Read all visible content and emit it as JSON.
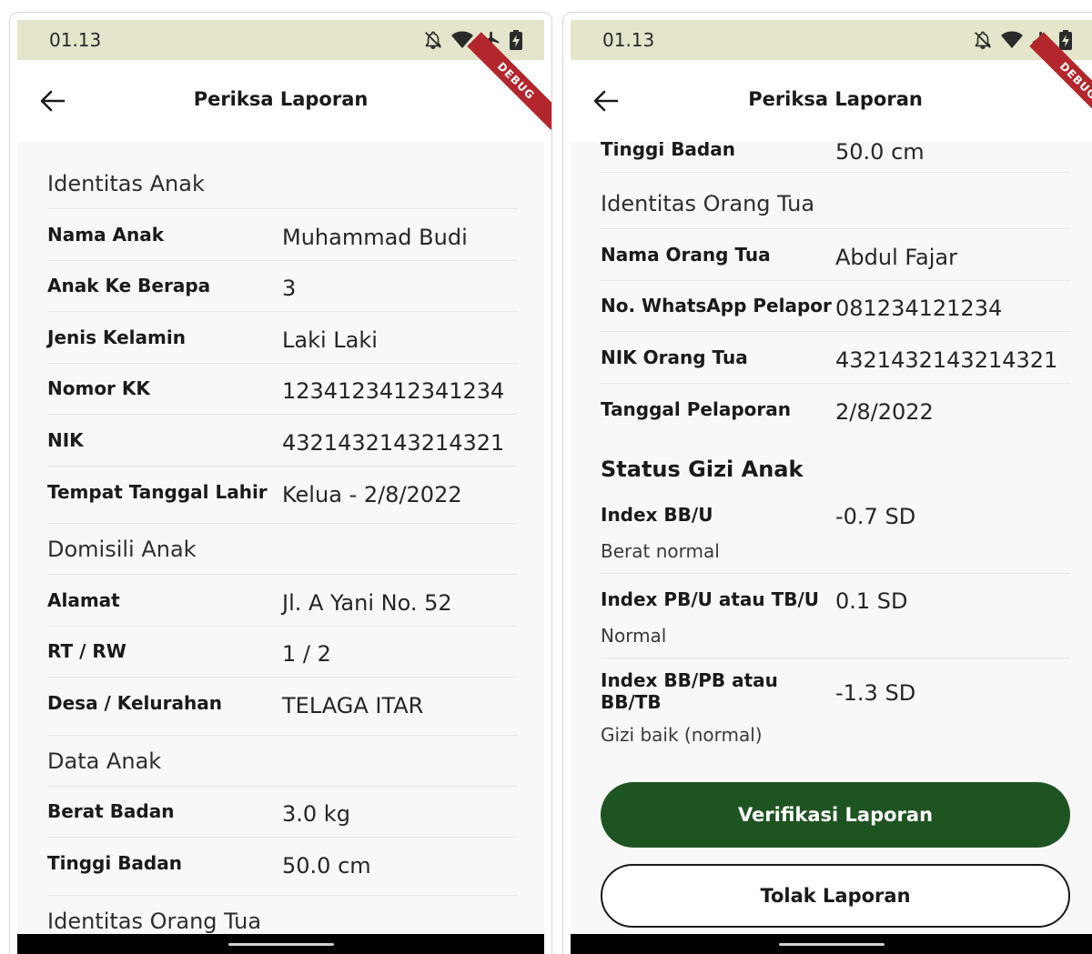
{
  "status_bar": {
    "time": "01.13"
  },
  "app_bar": {
    "title": "Periksa Laporan",
    "debug_label": "DEBUG"
  },
  "left": {
    "sections": [
      {
        "title": "Identitas Anak",
        "rows": [
          {
            "label": "Nama Anak",
            "value": "Muhammad Budi"
          },
          {
            "label": "Anak Ke Berapa",
            "value": "3"
          },
          {
            "label": "Jenis Kelamin",
            "value": "Laki Laki"
          },
          {
            "label": "Nomor KK",
            "value": "1234123412341234"
          },
          {
            "label": "NIK",
            "value": "4321432143214321"
          },
          {
            "label": "Tempat Tanggal Lahir",
            "value": "Kelua - 2/8/2022"
          }
        ]
      },
      {
        "title": "Domisili Anak",
        "rows": [
          {
            "label": "Alamat",
            "value": "Jl. A Yani No. 52"
          },
          {
            "label": "RT / RW",
            "value": "1 / 2"
          },
          {
            "label": "Desa / Kelurahan",
            "value": "TELAGA ITAR"
          }
        ]
      },
      {
        "title": "Data Anak",
        "rows": [
          {
            "label": "Berat Badan",
            "value": "3.0 kg"
          },
          {
            "label": "Tinggi Badan",
            "value": "50.0 cm"
          }
        ]
      }
    ],
    "partial_next_title": "Identitas Orang Tua"
  },
  "right": {
    "partial_row": {
      "label": "Tinggi Badan",
      "value": "50.0 cm"
    },
    "section": {
      "title": "Identitas Orang Tua",
      "rows": [
        {
          "label": "Nama Orang Tua",
          "value": "Abdul Fajar"
        },
        {
          "label": "No. WhatsApp Pelapor",
          "value": "081234121234"
        },
        {
          "label": "NIK Orang Tua",
          "value": "4321432143214321"
        },
        {
          "label": "Tanggal Pelaporan",
          "value": "2/8/2022"
        }
      ]
    },
    "status_gizi": {
      "title": "Status Gizi Anak",
      "items": [
        {
          "label": "Index BB/U",
          "value": "-0.7 SD",
          "desc": "Berat normal"
        },
        {
          "label": "Index PB/U atau TB/U",
          "value": "0.1 SD",
          "desc": "Normal"
        },
        {
          "label": "Index BB/PB atau BB/TB",
          "value": "-1.3 SD",
          "desc": "Gizi baik (normal)"
        }
      ]
    },
    "buttons": {
      "verify_label": "Verifikasi Laporan",
      "reject_label": "Tolak Laporan"
    }
  },
  "colors": {
    "status_bar_bg": "#e4e5cb",
    "primary_button": "#1e5322",
    "debug_ribbon": "#b3262c"
  }
}
